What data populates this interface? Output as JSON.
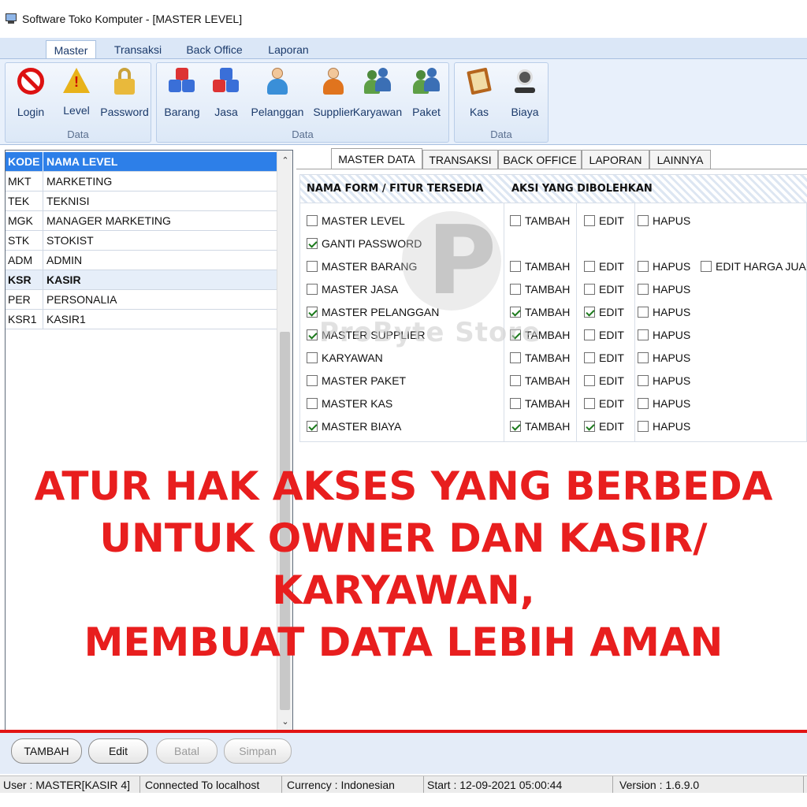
{
  "window": {
    "title": "Software Toko Komputer - [MASTER LEVEL]"
  },
  "ribbon": {
    "tabs": [
      "Master",
      "Transaksi",
      "Back Office",
      "Laporan"
    ],
    "groups": [
      {
        "label": "Data",
        "buttons": [
          {
            "label": "Login",
            "icon": "no-entry-icon"
          },
          {
            "label": "Level",
            "icon": "warning-icon"
          },
          {
            "label": "Password",
            "icon": "lock-icon"
          }
        ]
      },
      {
        "label": "Data",
        "buttons": [
          {
            "label": "Barang",
            "icon": "cubes-icon"
          },
          {
            "label": "Jasa",
            "icon": "cubes-icon"
          },
          {
            "label": "Pelanggan",
            "icon": "customer-icon"
          },
          {
            "label": "Supplier",
            "icon": "supplier-icon"
          },
          {
            "label": "Karyawan",
            "icon": "employees-icon"
          },
          {
            "label": "Paket",
            "icon": "package-users-icon"
          }
        ]
      },
      {
        "label": "Data",
        "buttons": [
          {
            "label": "Kas",
            "icon": "book-icon"
          },
          {
            "label": "Biaya",
            "icon": "webcam-icon"
          }
        ]
      }
    ]
  },
  "level_list": {
    "headers": [
      "KODE",
      "NAMA LEVEL"
    ],
    "rows": [
      [
        "MKT",
        "MARKETING"
      ],
      [
        "TEK",
        "TEKNISI"
      ],
      [
        "MGK",
        "MANAGER MARKETING"
      ],
      [
        "STK",
        "STOKIST"
      ],
      [
        "ADM",
        "ADMIN"
      ],
      [
        "KSR",
        "KASIR"
      ],
      [
        "PER",
        "PERSONALIA"
      ],
      [
        "KSR1",
        "KASIR1"
      ]
    ],
    "selected_index": 5
  },
  "permission_tabs": [
    "MASTER DATA",
    "TRANSAKSI",
    "BACK OFFICE",
    "LAPORAN",
    "LAINNYA"
  ],
  "permissions": {
    "header_form": "NAMA FORM /  FITUR TERSEDIA",
    "header_actions": "AKSI YANG DIBOLEHKAN",
    "action_labels": {
      "add": "TAMBAH",
      "edit": "EDIT",
      "delete": "HAPUS",
      "edit_price": "EDIT HARGA JUAL"
    },
    "rows": [
      {
        "form": "MASTER LEVEL",
        "checked": false,
        "add": false,
        "edit": false,
        "delete": false
      },
      {
        "form": "GANTI PASSWORD",
        "checked": true
      },
      {
        "form": "MASTER BARANG",
        "checked": false,
        "add": false,
        "edit": false,
        "delete": false,
        "edit_price": false
      },
      {
        "form": "MASTER JASA",
        "checked": false,
        "add": false,
        "edit": false,
        "delete": false
      },
      {
        "form": "MASTER PELANGGAN",
        "checked": true,
        "add": true,
        "edit": true,
        "delete": false
      },
      {
        "form": "MASTER SUPPLIER",
        "checked": true,
        "add": true,
        "edit": false,
        "delete": false
      },
      {
        "form": "KARYAWAN",
        "checked": false,
        "add": false,
        "edit": false,
        "delete": false
      },
      {
        "form": "MASTER PAKET",
        "checked": false,
        "add": false,
        "edit": false,
        "delete": false
      },
      {
        "form": "MASTER KAS",
        "checked": false,
        "add": false,
        "edit": false,
        "delete": false
      },
      {
        "form": "MASTER BIAYA",
        "checked": true,
        "add": true,
        "edit": true,
        "delete": false
      }
    ]
  },
  "watermark": {
    "text": "ProByte Store"
  },
  "banner": {
    "lines": [
      "ATUR HAK AKSES YANG BERBEDA",
      "UNTUK OWNER DAN KASIR/",
      "KARYAWAN,",
      "MEMBUAT DATA LEBIH AMAN"
    ]
  },
  "actions": {
    "add": "TAMBAH",
    "edit": "Edit",
    "cancel": "Batal",
    "save": "Simpan"
  },
  "status": {
    "user": "User : MASTER[KASIR 4]",
    "connection": "Connected To localhost",
    "currency": "Currency : Indonesian",
    "start": "Start  : 12-09-2021 05:00:44",
    "version": "Version : 1.6.9.0"
  },
  "colors": {
    "banner": "#e81e1e",
    "selection": "#2d7fe8",
    "accent_line": "#e21414"
  }
}
